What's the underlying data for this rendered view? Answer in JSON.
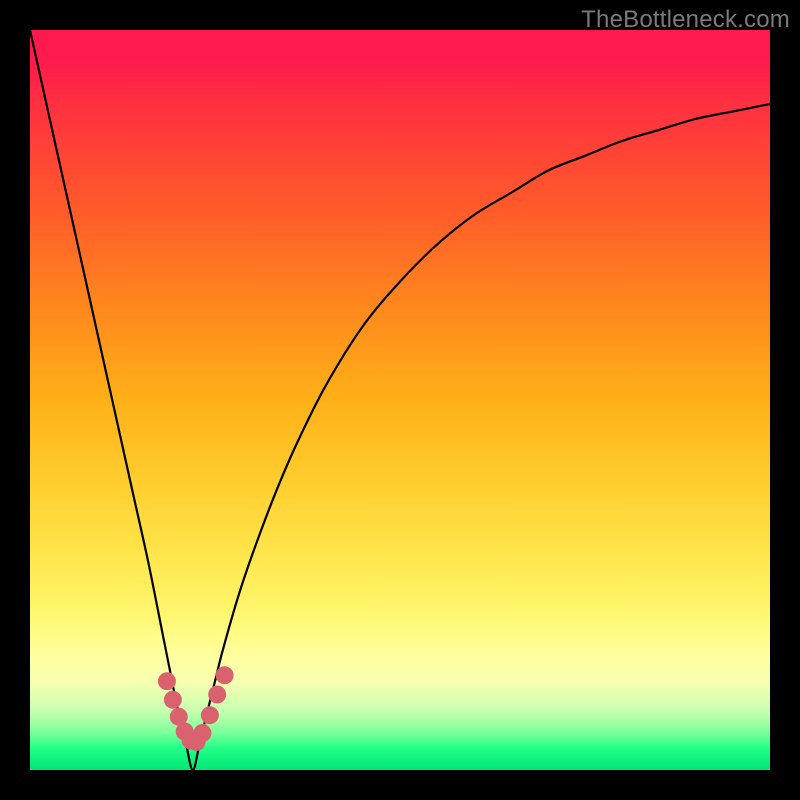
{
  "watermark": "TheBottleneck.com",
  "chart_data": {
    "type": "line",
    "title": "",
    "xlabel": "",
    "ylabel": "",
    "xlim": [
      0,
      100
    ],
    "ylim": [
      0,
      100
    ],
    "minimum_x": 22,
    "series": [
      {
        "name": "bottleneck-curve",
        "x": [
          0,
          2,
          4,
          6,
          8,
          10,
          12,
          14,
          16,
          18,
          19,
          20,
          21,
          22,
          23,
          24,
          25,
          26,
          28,
          30,
          33,
          36,
          40,
          45,
          50,
          55,
          60,
          65,
          70,
          75,
          80,
          85,
          90,
          95,
          100
        ],
        "y": [
          100,
          91,
          82,
          73,
          64,
          55,
          46,
          37,
          28,
          18,
          13,
          8,
          4,
          0,
          4,
          8,
          12,
          16,
          23,
          29,
          37,
          44,
          52,
          60,
          66,
          71,
          75,
          78,
          81,
          83,
          85,
          86.5,
          88,
          89,
          90
        ]
      }
    ],
    "markers": {
      "name": "highlight-points",
      "color": "#d9626e",
      "x": [
        18.5,
        19.3,
        20.1,
        20.9,
        21.7,
        22.5,
        23.3,
        24.3,
        25.3,
        26.3
      ],
      "y": [
        12,
        9.5,
        7.2,
        5.2,
        4.0,
        3.8,
        5.0,
        7.4,
        10.2,
        12.8
      ]
    }
  }
}
